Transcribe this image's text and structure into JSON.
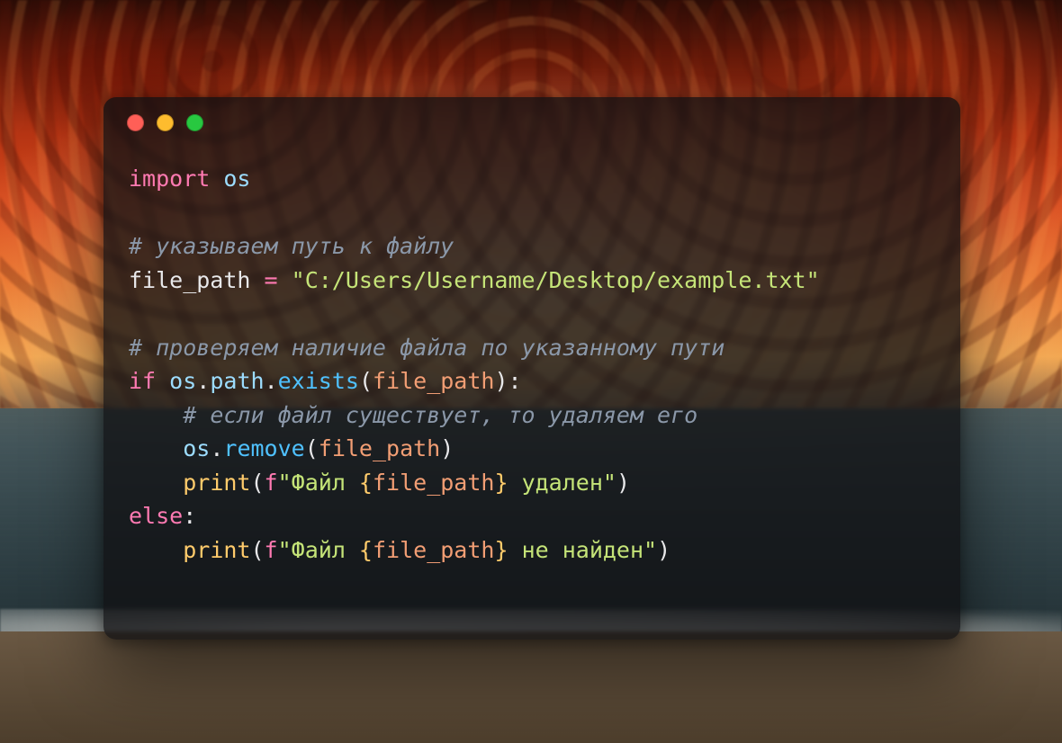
{
  "window": {
    "traffic_lights": [
      "close",
      "minimize",
      "zoom"
    ]
  },
  "code": {
    "language": "python",
    "lines": [
      {
        "t": "import",
        "tokens": [
          {
            "c": "tok-kw",
            "v": "import"
          },
          {
            "c": "",
            "v": " "
          },
          {
            "c": "tok-mod",
            "v": "os"
          }
        ]
      },
      {
        "t": "blank",
        "v": ""
      },
      {
        "t": "comment",
        "tokens": [
          {
            "c": "tok-comment",
            "v": "# указываем путь к файлу"
          }
        ]
      },
      {
        "t": "assign",
        "tokens": [
          {
            "c": "tok-var",
            "v": "file_path"
          },
          {
            "c": "",
            "v": " "
          },
          {
            "c": "tok-op",
            "v": "="
          },
          {
            "c": "",
            "v": " "
          },
          {
            "c": "tok-str",
            "v": "\"C:/Users/Username/Desktop/example.txt\""
          }
        ]
      },
      {
        "t": "blank",
        "v": ""
      },
      {
        "t": "comment",
        "tokens": [
          {
            "c": "tok-comment",
            "v": "# проверяем наличие файла по указанному пути"
          }
        ]
      },
      {
        "t": "if",
        "tokens": [
          {
            "c": "tok-kw",
            "v": "if"
          },
          {
            "c": "",
            "v": " "
          },
          {
            "c": "tok-mod",
            "v": "os"
          },
          {
            "c": "tok-punct",
            "v": "."
          },
          {
            "c": "tok-attr",
            "v": "path"
          },
          {
            "c": "tok-punct",
            "v": "."
          },
          {
            "c": "tok-func",
            "v": "exists"
          },
          {
            "c": "tok-punct",
            "v": "("
          },
          {
            "c": "tok-arg",
            "v": "file_path"
          },
          {
            "c": "tok-punct",
            "v": ")"
          },
          {
            "c": "tok-punct",
            "v": ":"
          }
        ]
      },
      {
        "t": "comment-indent",
        "tokens": [
          {
            "c": "",
            "v": "    "
          },
          {
            "c": "tok-comment",
            "v": "# если файл существует, то удаляем его"
          }
        ]
      },
      {
        "t": "stmt",
        "tokens": [
          {
            "c": "",
            "v": "    "
          },
          {
            "c": "tok-mod",
            "v": "os"
          },
          {
            "c": "tok-punct",
            "v": "."
          },
          {
            "c": "tok-func",
            "v": "remove"
          },
          {
            "c": "tok-punct",
            "v": "("
          },
          {
            "c": "tok-arg",
            "v": "file_path"
          },
          {
            "c": "tok-punct",
            "v": ")"
          }
        ]
      },
      {
        "t": "print",
        "tokens": [
          {
            "c": "",
            "v": "    "
          },
          {
            "c": "tok-call",
            "v": "print"
          },
          {
            "c": "tok-punct",
            "v": "("
          },
          {
            "c": "tok-fprefix",
            "v": "f"
          },
          {
            "c": "tok-str",
            "v": "\"Файл "
          },
          {
            "c": "tok-brace",
            "v": "{"
          },
          {
            "c": "tok-interp",
            "v": "file_path"
          },
          {
            "c": "tok-brace",
            "v": "}"
          },
          {
            "c": "tok-str",
            "v": " удален\""
          },
          {
            "c": "tok-punct",
            "v": ")"
          }
        ]
      },
      {
        "t": "else",
        "tokens": [
          {
            "c": "tok-kw",
            "v": "else"
          },
          {
            "c": "tok-punct",
            "v": ":"
          }
        ]
      },
      {
        "t": "print",
        "tokens": [
          {
            "c": "",
            "v": "    "
          },
          {
            "c": "tok-call",
            "v": "print"
          },
          {
            "c": "tok-punct",
            "v": "("
          },
          {
            "c": "tok-fprefix",
            "v": "f"
          },
          {
            "c": "tok-str",
            "v": "\"Файл "
          },
          {
            "c": "tok-brace",
            "v": "{"
          },
          {
            "c": "tok-interp",
            "v": "file_path"
          },
          {
            "c": "tok-brace",
            "v": "}"
          },
          {
            "c": "tok-str",
            "v": " не найден\""
          },
          {
            "c": "tok-punct",
            "v": ")"
          }
        ]
      }
    ]
  }
}
